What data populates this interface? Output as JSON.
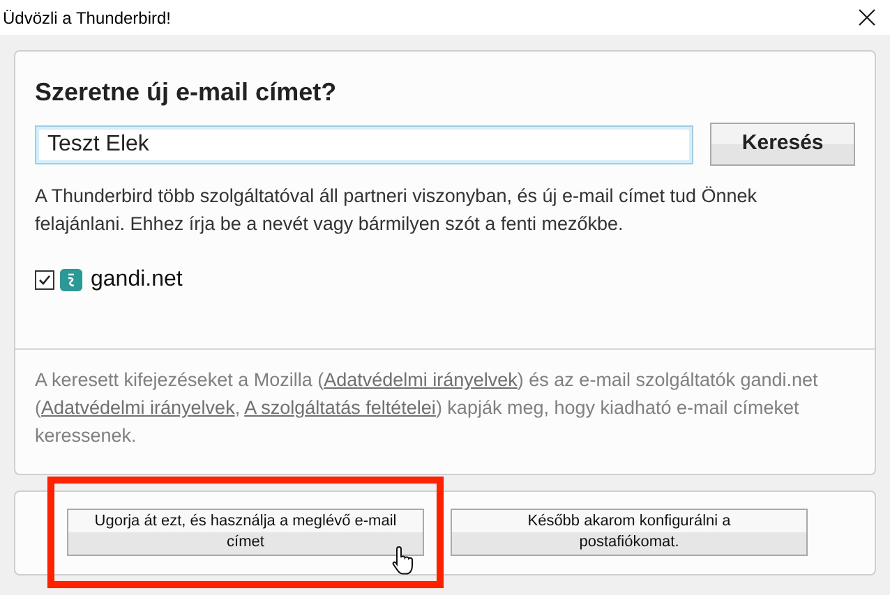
{
  "window": {
    "title": "Üdvözli a Thunderbird!"
  },
  "heading": "Szeretne új e-mail címet?",
  "search": {
    "value": "Teszt Elek",
    "button": "Keresés"
  },
  "description": "A Thunderbird több szolgáltatóval áll partneri viszonyban, és új e-mail címet tud Önnek felajánlani. Ehhez írja be a nevét vagy bármilyen szót a fenti mezőkbe.",
  "providers": [
    {
      "name": "gandi.net",
      "checked": true
    }
  ],
  "disclaimer": [
    {
      "kind": "text",
      "text": "A keresett kifejezéseket a Mozilla ("
    },
    {
      "kind": "link",
      "text": "Adatvédelmi irányelvek"
    },
    {
      "kind": "text",
      "text": ") és az e-mail szolgáltatók gandi.net ("
    },
    {
      "kind": "link",
      "text": "Adatvédelmi irányelvek"
    },
    {
      "kind": "text",
      "text": ", "
    },
    {
      "kind": "link",
      "text": "A szolgáltatás feltételei"
    },
    {
      "kind": "text",
      "text": ") kapják meg, hogy kiadható e-mail címeket keressenek."
    }
  ],
  "buttons": [
    {
      "label": "Ugorja át ezt, és használja a meglévő e-mail címet",
      "highlighted": true,
      "hovered": true
    },
    {
      "label": "Később akarom konfigurálni a postafiókomat.",
      "highlighted": false,
      "hovered": false
    }
  ]
}
